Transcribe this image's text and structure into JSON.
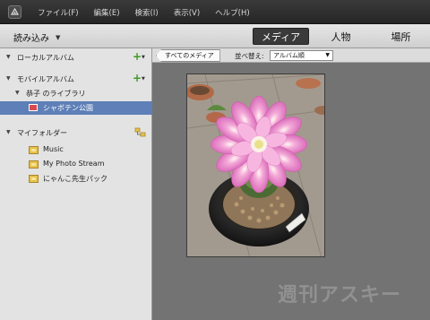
{
  "menubar": {
    "items": [
      "ファイル(F)",
      "編集(E)",
      "検索(I)",
      "表示(V)",
      "ヘルプ(H)"
    ]
  },
  "toolbar": {
    "import_label": "読み込み",
    "view_tabs": [
      {
        "label": "メディア",
        "active": true
      },
      {
        "label": "人物",
        "active": false
      },
      {
        "label": "場所",
        "active": false
      }
    ]
  },
  "sidebar": {
    "local_albums": "ローカルアルバム",
    "mobile_albums": "モバイルアルバム",
    "library": "恭子 のライブラリ",
    "selected_album": "シャボテン公園",
    "my_folders": "マイフォルダー",
    "folders": [
      "Music",
      "My Photo Stream",
      "にゃんこ先生パック"
    ]
  },
  "main": {
    "all_media_label": "すべてのメディア",
    "sort_label": "並べ替え:",
    "sort_value": "アルバム順"
  },
  "watermark": "週刊アスキー",
  "colors": {
    "selection": "#5e7fb7",
    "add_icon": "#3f9a27",
    "folder": "#e8c24a"
  }
}
